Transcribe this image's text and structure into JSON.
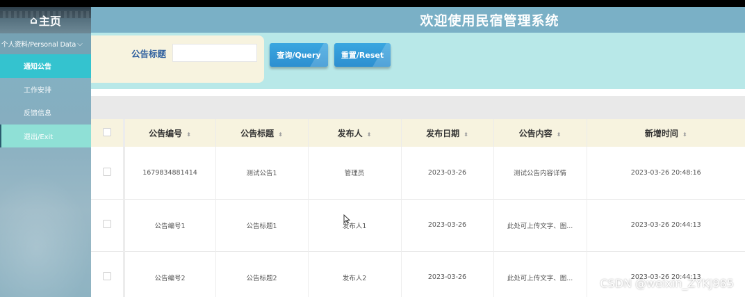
{
  "sidebar": {
    "title": "主页",
    "home_icon": "home-icon",
    "group_label": "个人资料/Personal Data",
    "items": [
      {
        "label": "通知公告",
        "active": true
      },
      {
        "label": "工作安排",
        "active": false
      },
      {
        "label": "反馈信息",
        "active": false
      },
      {
        "label": "退出/Exit",
        "active": false
      }
    ]
  },
  "header": {
    "title": "欢迎使用民宿管理系统"
  },
  "search": {
    "label": "公告标题",
    "value": "",
    "query_label": "查询/Query",
    "reset_label": "重置/Reset"
  },
  "table": {
    "columns": [
      "公告编号",
      "公告标题",
      "发布人",
      "发布日期",
      "公告内容",
      "新增时间"
    ],
    "rows": [
      [
        "1679834881414",
        "测试公告1",
        "管理员",
        "2023-03-26",
        "测试公告内容详情",
        "2023-03-26 20:48:16"
      ],
      [
        "公告编号1",
        "公告标题1",
        "发布人1",
        "2023-03-26",
        "此处可上传文字、图...",
        "2023-03-26 20:44:13"
      ],
      [
        "公告编号2",
        "公告标题2",
        "发布人2",
        "2023-03-26",
        "此处可上传文字、图...",
        "2023-03-26 20:44:13"
      ]
    ]
  },
  "watermark": "CSDN @weixin_ZYKJ985",
  "colors": {
    "header_bg": "#7ab0c6",
    "active_menu": "#34c3cf",
    "search_band": "#b8e8e8",
    "button": "#2d8fd0",
    "table_head": "#f7f3df"
  }
}
